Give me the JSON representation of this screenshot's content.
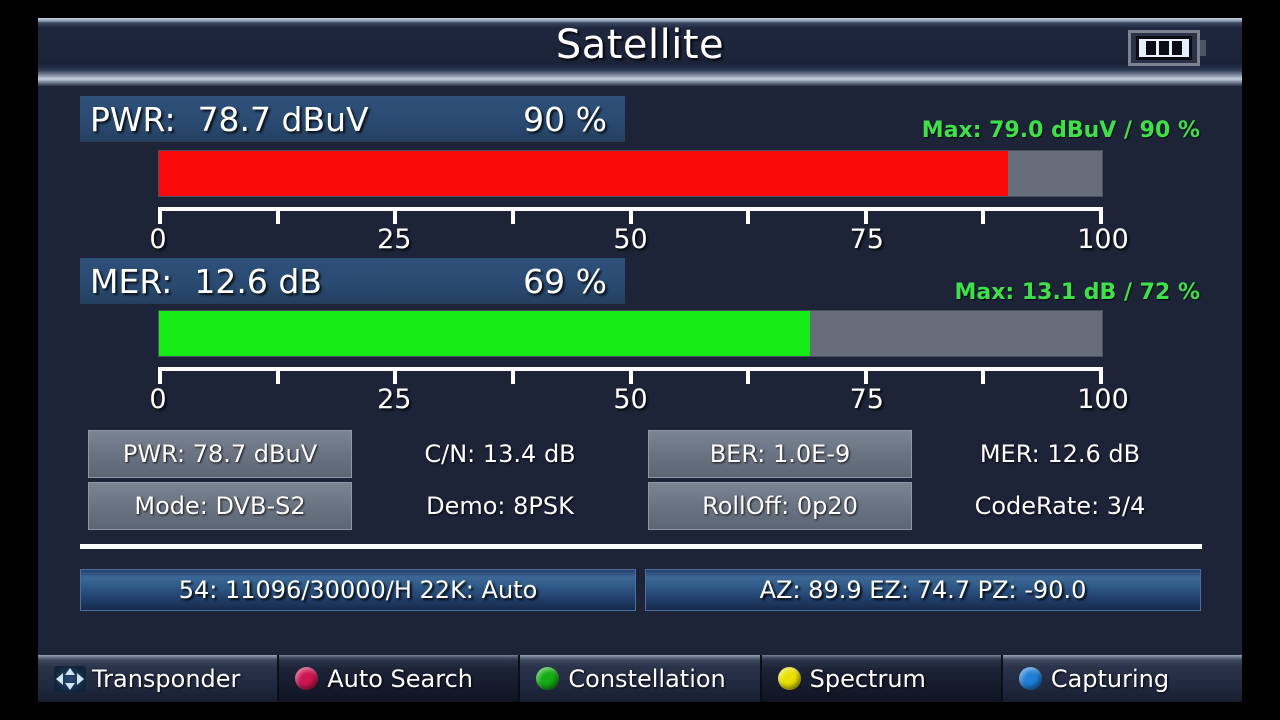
{
  "window": {
    "title": "Satellite",
    "battery_icon": "battery-icon",
    "battery_cells": 3
  },
  "colors": {
    "pwr_bar": "#fa0a0a",
    "mer_bar": "#15ec15",
    "bar_track": "#676d78",
    "max_text": "#3fe04a",
    "panel_blue": "#2e5179"
  },
  "meters": [
    {
      "label": "PWR:",
      "value": "78.7 dBuV",
      "percent_text": "90 %",
      "percent": 90,
      "max_text": "Max: 79.0 dBuV / 90 %",
      "bar_color_name": "red"
    },
    {
      "label": "MER:",
      "value": "12.6 dB",
      "percent_text": "69 %",
      "percent": 69,
      "max_text": "Max: 13.1 dB  / 72 %",
      "bar_color_name": "green"
    }
  ],
  "scale": {
    "labels": [
      "0",
      "25",
      "50",
      "75",
      "100"
    ],
    "tick_count": 9,
    "min": 0,
    "max": 100
  },
  "info_grid": {
    "row1": [
      {
        "text": "PWR: 78.7 dBuV",
        "highlighted": true
      },
      {
        "text": "C/N: 13.4 dB",
        "highlighted": false
      },
      {
        "text": "BER: 1.0E-9",
        "highlighted": true
      },
      {
        "text": "MER: 12.6 dB",
        "highlighted": false
      }
    ],
    "row2": [
      {
        "text": "Mode: DVB-S2",
        "highlighted": true
      },
      {
        "text": "Demo: 8PSK",
        "highlighted": false
      },
      {
        "text": "RollOff: 0p20",
        "highlighted": true
      },
      {
        "text": "CodeRate: 3/4",
        "highlighted": false
      }
    ]
  },
  "status_bars": {
    "transponder": "54: 11096/30000/H 22K: Auto",
    "position": "AZ: 89.9  EZ: 74.7  PZ: -90.0"
  },
  "toolbar": [
    {
      "label": "Transponder",
      "icon": "dpad-icon",
      "color": "",
      "dark": false
    },
    {
      "label": "Auto Search",
      "icon": "red-dot-icon",
      "color": "#cc1551",
      "dark": true
    },
    {
      "label": "Constellation",
      "icon": "green-dot-icon",
      "color": "#13ad13",
      "dark": false
    },
    {
      "label": "Spectrum",
      "icon": "yellow-dot-icon",
      "color": "#e8e000",
      "dark": true
    },
    {
      "label": "Capturing",
      "icon": "blue-dot-icon",
      "color": "#1f7fd6",
      "dark": false
    }
  ]
}
